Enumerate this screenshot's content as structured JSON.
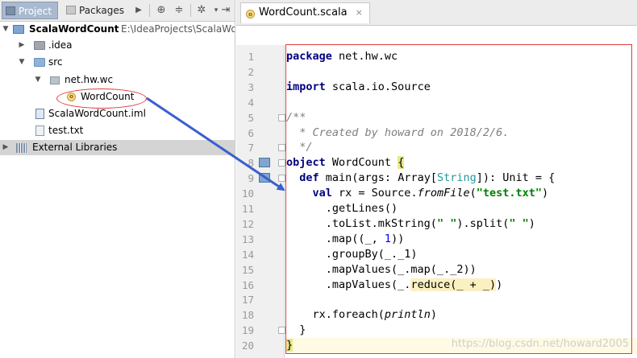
{
  "left_panel": {
    "tabs": [
      {
        "label": "Project",
        "active": true
      },
      {
        "label": "Packages",
        "active": false
      }
    ],
    "toolbar_icons": [
      "chevron-right-icon",
      "locate-icon",
      "collapse-all-icon",
      "gear-icon",
      "hide-icon"
    ],
    "tree": [
      {
        "label": "ScalaWordCount",
        "path": "E:\\IdeaProjects\\ScalaWo",
        "icon": "module-folder-icon",
        "expanded": true
      },
      {
        "label": ".idea",
        "icon": "folder-icon",
        "expanded": false
      },
      {
        "label": "src",
        "icon": "source-folder-icon",
        "expanded": true
      },
      {
        "label": "net.hw.wc",
        "icon": "package-icon",
        "expanded": true
      },
      {
        "label": "WordCount",
        "icon": "scala-object-icon"
      },
      {
        "label": "ScalaWordCount.iml",
        "icon": "iml-file-icon"
      },
      {
        "label": "test.txt",
        "icon": "text-file-icon"
      },
      {
        "label": "External Libraries",
        "icon": "library-icon",
        "expanded": false
      }
    ]
  },
  "editor": {
    "tab": {
      "label": "WordCount.scala",
      "close": "×"
    },
    "current_line": 20,
    "lines": [
      {
        "n": "1",
        "code": "package net.hw.wc"
      },
      {
        "n": "2",
        "code": ""
      },
      {
        "n": "3",
        "code": "import scala.io.Source"
      },
      {
        "n": "4",
        "code": ""
      },
      {
        "n": "5",
        "code": "/**"
      },
      {
        "n": "6",
        "code": "  * Created by howard on 2018/2/6."
      },
      {
        "n": "7",
        "code": "  */"
      },
      {
        "n": "8",
        "code": "object WordCount {"
      },
      {
        "n": "9",
        "code": "  def main(args: Array[String]): Unit = {"
      },
      {
        "n": "10",
        "code": "    val rx = Source.fromFile(\"test.txt\")"
      },
      {
        "n": "11",
        "code": "      .getLines()"
      },
      {
        "n": "12",
        "code": "      .toList.mkString(\" \").split(\" \")"
      },
      {
        "n": "13",
        "code": "      .map((_, 1))"
      },
      {
        "n": "14",
        "code": "      .groupBy(_._1)"
      },
      {
        "n": "15",
        "code": "      .mapValues(_.map(_._2))"
      },
      {
        "n": "16",
        "code": "      .mapValues(_.reduce(_ + _))"
      },
      {
        "n": "17",
        "code": ""
      },
      {
        "n": "18",
        "code": "    rx.foreach(println)"
      },
      {
        "n": "19",
        "code": "  }"
      },
      {
        "n": "20",
        "code": "}"
      }
    ]
  },
  "watermark": "https://blog.csdn.net/howard2005",
  "colors": {
    "annotation_red": "#e23a3a",
    "annotation_arrow": "#3a5fcf",
    "keyword": "#000080",
    "string": "#008000"
  }
}
